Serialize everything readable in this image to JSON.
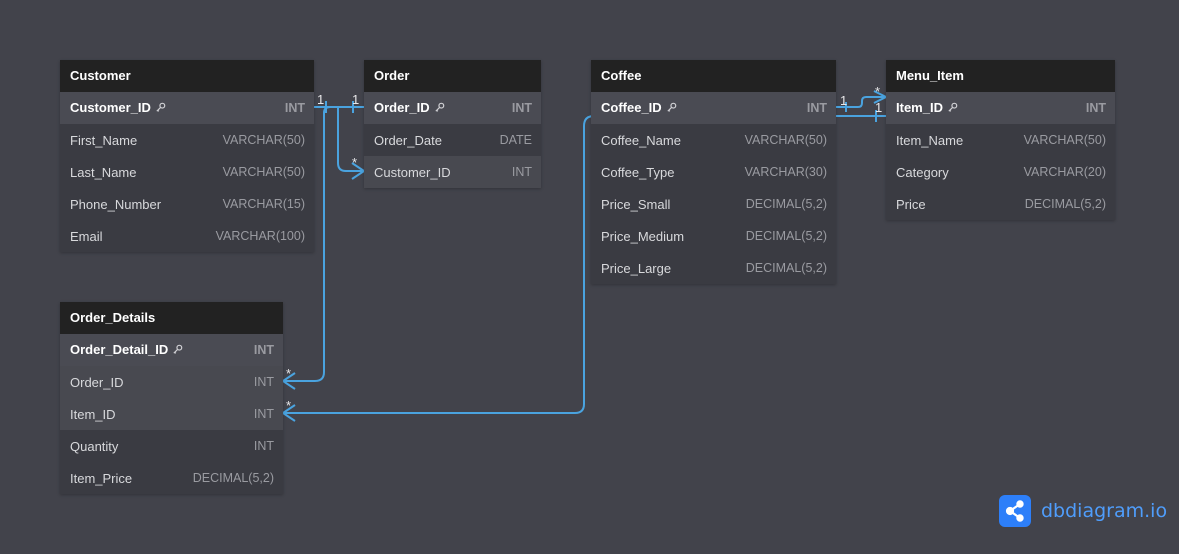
{
  "app": {
    "brand": "dbdiagram.io"
  },
  "colors": {
    "background": "#42434b",
    "header": "#222222",
    "relation_line": "#4aa3df",
    "brand": "#2d7ff9"
  },
  "tables": {
    "customer": {
      "name": "Customer",
      "fields": [
        {
          "name": "Customer_ID",
          "type": "INT",
          "pk": true
        },
        {
          "name": "First_Name",
          "type": "VARCHAR(50)"
        },
        {
          "name": "Last_Name",
          "type": "VARCHAR(50)"
        },
        {
          "name": "Phone_Number",
          "type": "VARCHAR(15)"
        },
        {
          "name": "Email",
          "type": "VARCHAR(100)"
        }
      ]
    },
    "order": {
      "name": "Order",
      "fields": [
        {
          "name": "Order_ID",
          "type": "INT",
          "pk": true
        },
        {
          "name": "Order_Date",
          "type": "DATE"
        },
        {
          "name": "Customer_ID",
          "type": "INT"
        }
      ]
    },
    "coffee": {
      "name": "Coffee",
      "fields": [
        {
          "name": "Coffee_ID",
          "type": "INT",
          "pk": true
        },
        {
          "name": "Coffee_Name",
          "type": "VARCHAR(50)"
        },
        {
          "name": "Coffee_Type",
          "type": "VARCHAR(30)"
        },
        {
          "name": "Price_Small",
          "type": "DECIMAL(5,2)"
        },
        {
          "name": "Price_Medium",
          "type": "DECIMAL(5,2)"
        },
        {
          "name": "Price_Large",
          "type": "DECIMAL(5,2)"
        }
      ]
    },
    "menu_item": {
      "name": "Menu_Item",
      "fields": [
        {
          "name": "Item_ID",
          "type": "INT",
          "pk": true
        },
        {
          "name": "Item_Name",
          "type": "VARCHAR(50)"
        },
        {
          "name": "Category",
          "type": "VARCHAR(20)"
        },
        {
          "name": "Price",
          "type": "DECIMAL(5,2)"
        }
      ]
    },
    "order_details": {
      "name": "Order_Details",
      "fields": [
        {
          "name": "Order_Detail_ID",
          "type": "INT",
          "pk": true
        },
        {
          "name": "Order_ID",
          "type": "INT"
        },
        {
          "name": "Item_ID",
          "type": "INT"
        },
        {
          "name": "Quantity",
          "type": "INT"
        },
        {
          "name": "Item_Price",
          "type": "DECIMAL(5,2)"
        }
      ]
    }
  },
  "relationships": [
    {
      "from": "Customer.Customer_ID",
      "to": "Order.Customer_ID",
      "from_card": "1",
      "to_card": "*"
    },
    {
      "from": "Order.Order_ID",
      "to": "Order_Details.Order_ID",
      "from_card": "1",
      "to_card": "*"
    },
    {
      "from": "Coffee.Coffee_ID",
      "to": "Order_Details.Item_ID",
      "from_card": "",
      "to_card": "*"
    },
    {
      "from": "Coffee.Coffee_ID",
      "to": "Menu_Item.Item_ID",
      "from_card": "1",
      "to_card": "1"
    },
    {
      "from": "Menu_Item.Item_ID",
      "to": "Coffee.Coffee_ID",
      "from_card": "*",
      "to_card": ""
    }
  ],
  "cardinality_labels": {
    "customer_one": "1",
    "order_one": "1",
    "order_customer_many": "*",
    "details_order_many": "*",
    "details_item_many": "*",
    "coffee_one": "1",
    "menu_many": "*",
    "menu_one": "1"
  }
}
